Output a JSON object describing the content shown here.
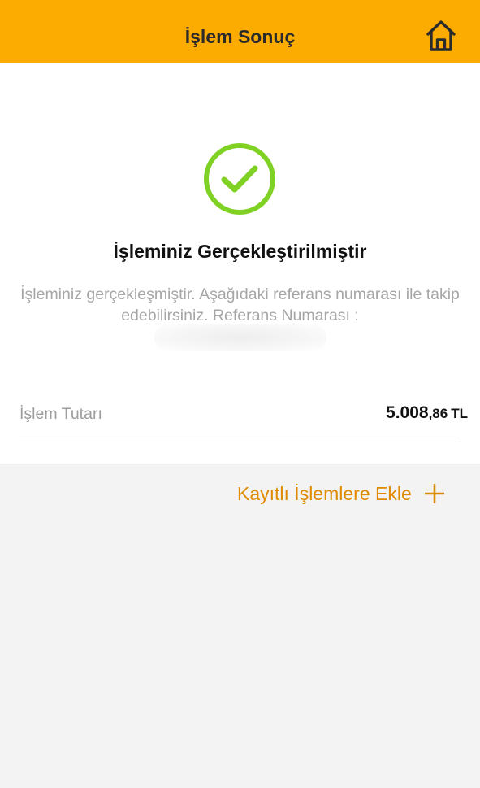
{
  "header": {
    "title": "İşlem Sonuç",
    "home_icon": "home-icon"
  },
  "result": {
    "status_icon": "check-circle-icon",
    "title": "İşleminiz Gerçekleştirilmiştir",
    "description": "İşleminiz gerçekleşmiştir. Aşağıdaki referans numarası ile takip edebilirsiniz. Referans Numarası :"
  },
  "amount": {
    "label": "İşlem Tutarı",
    "integer": "5.008",
    "decimal": ",86",
    "currency": "TL"
  },
  "actions": {
    "save_label": "Kayıtlı İşlemlere Ekle",
    "save_icon": "plus-icon"
  },
  "colors": {
    "header_bg": "#fcac00",
    "success_green": "#7fd124",
    "accent_orange": "#e08a00",
    "page_bg": "#f3f3f3"
  }
}
